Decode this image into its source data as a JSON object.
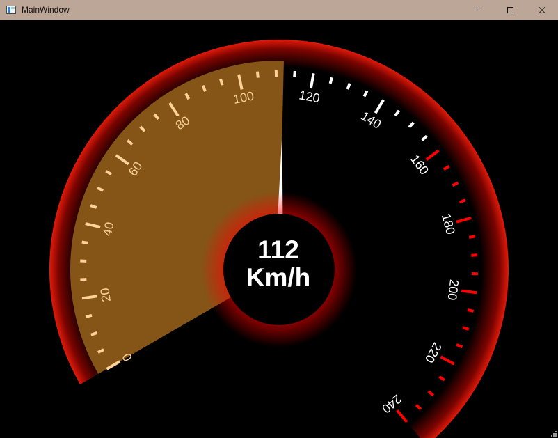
{
  "window": {
    "title": "MainWindow",
    "controls": {
      "minimize": "minimize",
      "maximize": "maximize",
      "close": "close"
    }
  },
  "gauge": {
    "value": 112,
    "value_label": "112",
    "unit": "Km/h",
    "min": 0,
    "max": 240,
    "major_step": 20,
    "minor_step": 5,
    "labels": [
      "0",
      "20",
      "40",
      "60",
      "80",
      "100",
      "120",
      "140",
      "160",
      "180",
      "200",
      "220",
      "240"
    ],
    "redline_from": 160,
    "colors": {
      "rim": "#d01808",
      "fill": "#855417",
      "tick_filled": "#ffd29a",
      "tick": "#ffffff",
      "redline_tick": "#ff0000",
      "label_filled": "#f7cf95",
      "label": "#ffffff",
      "needle": "#ffffff",
      "hub_glow": "#ff0000"
    }
  }
}
